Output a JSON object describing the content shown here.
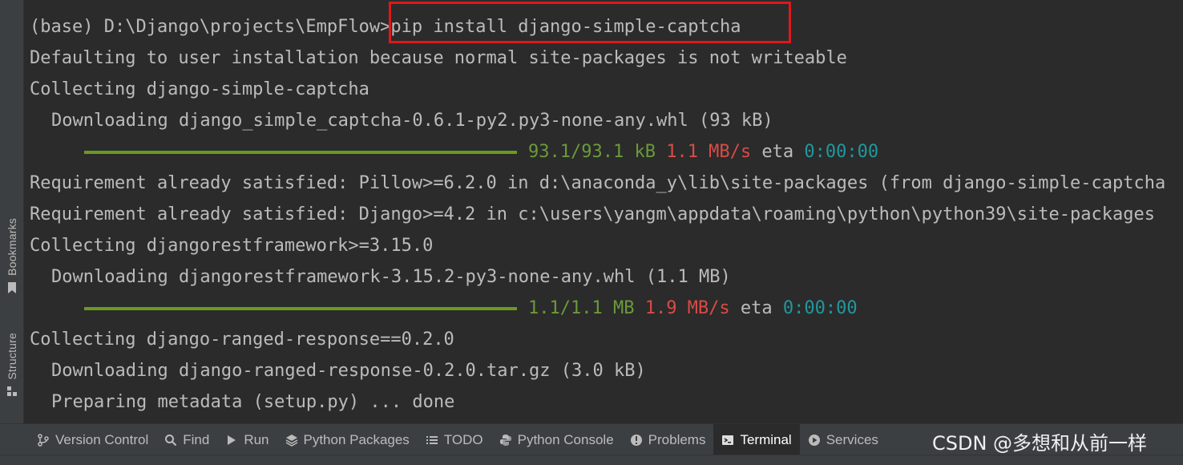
{
  "side_tabs": {
    "bookmarks": "Bookmarks",
    "structure": "Structure"
  },
  "terminal": {
    "line1": {
      "prompt": "(base) D:\\Django\\projects\\EmpFlow>",
      "command": "pip install django-simple-captcha"
    },
    "line2": "Defaulting to user installation because normal site-packages is not writeable",
    "line3": "Collecting django-simple-captcha",
    "line4": "Downloading django_simple_captcha-0.6.1-py2.py3-none-any.whl (93 kB)",
    "progress1": {
      "fraction": 1.0,
      "size": "93.1/93.1 kB",
      "speed": "1.1 MB/s",
      "eta_label": "eta",
      "eta": "0:00:00"
    },
    "line6": "Requirement already satisfied: Pillow>=6.2.0 in d:\\anaconda_y\\lib\\site-packages (from django-simple-captcha",
    "line7": "Requirement already satisfied: Django>=4.2 in c:\\users\\yangm\\appdata\\roaming\\python\\python39\\site-packages",
    "line8": "Collecting djangorestframework>=3.15.0",
    "line9": "Downloading djangorestframework-3.15.2-py3-none-any.whl (1.1 MB)",
    "progress2": {
      "fraction": 1.0,
      "size": "1.1/1.1 MB",
      "speed": "1.9 MB/s",
      "eta_label": "eta",
      "eta": "0:00:00"
    },
    "line11": "Collecting django-ranged-response==0.2.0",
    "line12": "Downloading django-ranged-response-0.2.0.tar.gz (3.0 kB)",
    "line13": "Preparing metadata (setup.py) ... done"
  },
  "bottom_tabs": [
    {
      "label": "Version Control",
      "icon": "branch-icon"
    },
    {
      "label": "Find",
      "icon": "search-icon"
    },
    {
      "label": "Run",
      "icon": "play-icon"
    },
    {
      "label": "Python Packages",
      "icon": "layers-icon"
    },
    {
      "label": "TODO",
      "icon": "list-icon"
    },
    {
      "label": "Python Console",
      "icon": "python-icon"
    },
    {
      "label": "Problems",
      "icon": "info-icon"
    },
    {
      "label": "Terminal",
      "icon": "terminal-icon",
      "active": true
    },
    {
      "label": "Services",
      "icon": "services-icon"
    }
  ],
  "watermark": "CSDN @多想和从前一样",
  "colors": {
    "background": "#2b2b2b",
    "text": "#bbbbbb",
    "progress_bar": "#6a9a1f",
    "progress_green": "#6a9a3a",
    "speed_red": "#d94b46",
    "eta_cyan": "#20999d",
    "highlight_box": "#e0171b"
  }
}
